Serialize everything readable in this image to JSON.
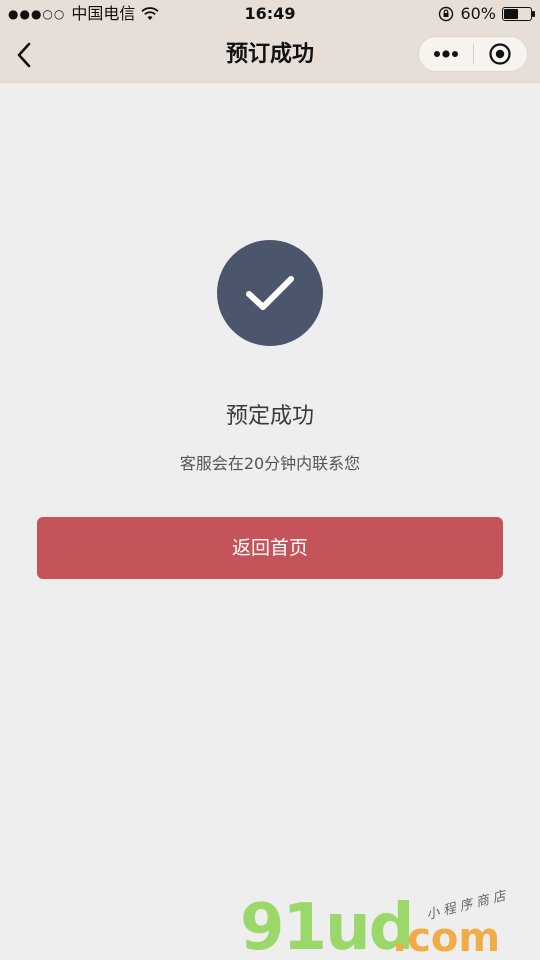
{
  "status_bar": {
    "signal": "●●●○○",
    "carrier": "中国电信",
    "time": "16:49",
    "battery_percent_text": "60%",
    "battery_level": 0.6
  },
  "nav": {
    "title": "预订成功"
  },
  "content": {
    "title": "预定成功",
    "subtitle": "客服会在20分钟内联系您",
    "home_button_label": "返回首页"
  },
  "watermark": {
    "brand": "91ud",
    "suffix": ".com",
    "tagline": "小程序商店"
  },
  "colors": {
    "nav_bg": "#e7dfd7",
    "page_bg": "#efeeee",
    "success_circle": "#4b566d",
    "primary_button": "#c5545a"
  }
}
